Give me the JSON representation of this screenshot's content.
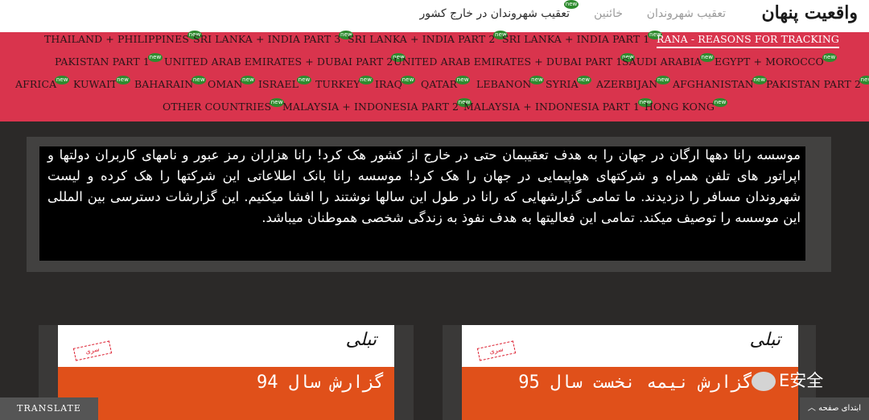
{
  "header": {
    "logo": "واقعیت پنهان",
    "nav": [
      {
        "label": "تعقیب شهروندان",
        "state": "inactive"
      },
      {
        "label": "خائنین",
        "state": "inactive"
      },
      {
        "label": "تعقیب شهروندان در خارج کشور",
        "state": "current",
        "badge": "new"
      }
    ]
  },
  "categories": [
    {
      "label": "THAILAND + PHILIPPINES",
      "badge": "new"
    },
    {
      "label": "SRI LANKA + INDIA PART 3",
      "badge": "new"
    },
    {
      "label": "SRI LANKA + INDIA PART 2",
      "badge": "new"
    },
    {
      "label": "SRI LANKA + INDIA PART 1",
      "badge": "new"
    },
    {
      "label": "RANA - REASONS FOR TRACKING",
      "active": true
    },
    {
      "label": "PAKISTAN PART 1",
      "badge": "new"
    },
    {
      "label": "UNITED ARAB EMIRATES + DUBAI PART 2",
      "badge": "new"
    },
    {
      "label": "UNITED ARAB EMIRATES + DUBAI PART 1",
      "badge": "new"
    },
    {
      "label": "SAUDI ARABIA",
      "badge": "new"
    },
    {
      "label": "EGYPT + MOROCCO",
      "badge": "new"
    },
    {
      "label": "AFRICA",
      "badge": "new"
    },
    {
      "label": "KUWAIT",
      "badge": "new"
    },
    {
      "label": "BAHARAIN",
      "badge": "new"
    },
    {
      "label": "OMAN",
      "badge": "new"
    },
    {
      "label": "ISRAEL",
      "badge": "new"
    },
    {
      "label": "TURKEY",
      "badge": "new"
    },
    {
      "label": "IRAQ",
      "badge": "new"
    },
    {
      "label": "QATAR",
      "badge": "new"
    },
    {
      "label": "LEBANON",
      "badge": "new"
    },
    {
      "label": "SYRIA",
      "badge": "new"
    },
    {
      "label": "AZERBIJAN",
      "badge": "new"
    },
    {
      "label": "AFGHANISTAN",
      "badge": "new"
    },
    {
      "label": "PAKISTAN PART 2",
      "badge": "new"
    },
    {
      "label": "OTHER COUNTRIES",
      "badge": "new"
    },
    {
      "label": "MALAYSIA + INDONESIA PART 2",
      "badge": "new"
    },
    {
      "label": "MALAYSIA + INDONESIA PART 1",
      "badge": "new"
    },
    {
      "label": "HONG KONG",
      "badge": "new"
    }
  ],
  "intro": "موسسه رانا دهها ارگان در جهان را به هدف تعقیبمان حتی در خارج از کشور هک کرد! رانا هزاران رمز عبور و نامهای کاربران دولتها و اپراتور های تلفن همراه و شرکتهای هواپیمایی در جهان را هک کرد! موسسه رانا بانک اطلاعاتی این شرکتها را هک کرده و لیست شهروندان مسافر را دزدیدند. ما تمامی گزارشهایی که رانا در طول این سالها نوشتند را افشا میکنیم. این گزارشات دسترسی بین المللی این موسسه را توصیف میکند. تمامی این فعالیتها به هدف نفوذ به زندگی شخصی هموطنان میباشد.",
  "cards": [
    {
      "brand": "تبلی",
      "stamp": "سری",
      "title": "گزارش سال 94"
    },
    {
      "brand": "تبلی",
      "stamp": "سری",
      "title": "گزارش نیمه نخست سال 95"
    }
  ],
  "widgets": {
    "translate": "TRANSLATE",
    "watermark": "E安全",
    "to_top": "ابتدای صفحه"
  },
  "colors": {
    "accent": "#d9344d",
    "badge": "#2e8b2e",
    "card_orange": "#e0501a",
    "background": "#2b2928"
  }
}
